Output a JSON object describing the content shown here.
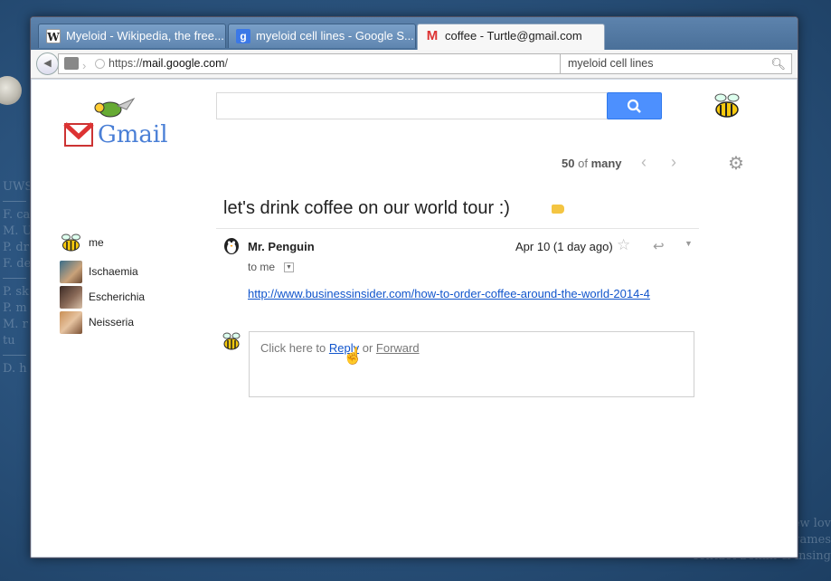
{
  "desktop": {
    "left_lines_1": [
      "UWS"
    ],
    "left_lines_2": [
      "F. ca",
      "M. U",
      "P. dr",
      "F. de"
    ],
    "left_lines_3": [
      "P. sk",
      "P. m",
      "M. r",
      "  tu"
    ],
    "left_lines_4": [
      "D. h"
    ],
    "right_lines": [
      "ew lov",
      "brain health games",
      "contact belkin & insing"
    ]
  },
  "browser": {
    "tabs": [
      {
        "label": "Myeloid - Wikipedia, the free...",
        "icon": "wikipedia-icon",
        "active": false
      },
      {
        "label": "myeloid cell lines - Google S...",
        "icon": "google-icon",
        "active": false
      },
      {
        "label": "coffee - Turtle@gmail.com",
        "icon": "gmail-icon",
        "active": true
      }
    ],
    "url_scheme": "https://",
    "url_host": "mail.google.com",
    "url_path": "/",
    "search_value": "myeloid cell lines"
  },
  "gmail": {
    "logo_text": "Gmail",
    "search_value": "",
    "pager": {
      "current": "50",
      "of": "of",
      "total": "many"
    }
  },
  "people": [
    {
      "name": "me",
      "avatar": "bee-avatar"
    },
    {
      "name": "Ischaemia",
      "avatar": "photo-avatar"
    },
    {
      "name": "Escherichia",
      "avatar": "photo-avatar"
    },
    {
      "name": "Neisseria",
      "avatar": "photo-avatar"
    }
  ],
  "message": {
    "subject": "let's drink coffee on our world tour :)",
    "sender": "Mr. Penguin",
    "date": "Apr 10 (1 day ago)",
    "to": "to me",
    "link": "http://www.businessinsider.com/how-to-order-coffee-around-the-world-2014-4"
  },
  "reply": {
    "prefix": "Click here to ",
    "reply_label": "Reply",
    "or": " or ",
    "forward_label": "Forward"
  },
  "colors": {
    "search_button": "#4d90fe",
    "label_tag": "#f4c542",
    "link": "#1155cc"
  }
}
